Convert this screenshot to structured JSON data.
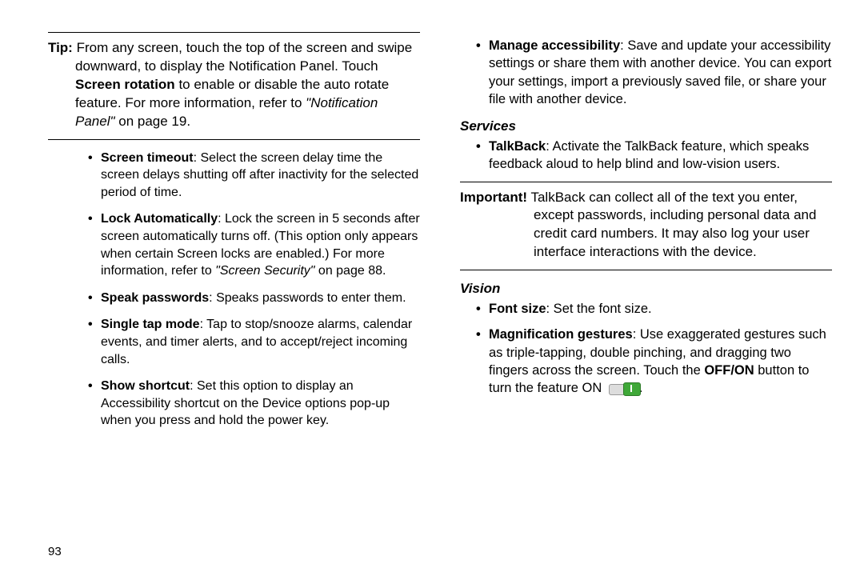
{
  "page_number": "93",
  "left": {
    "tip": {
      "label": "Tip:",
      "text_1": "From any screen, touch the top of the screen and swipe downward, to display the Notification Panel. Touch ",
      "screen_rotation": "Screen rotation",
      "text_2": " to enable or disable the auto rotate feature. For more information, refer to ",
      "ref": "\"Notification Panel\"",
      "text_3": " on page 19."
    },
    "items": [
      {
        "term": "Screen timeout",
        "body": ": Select the screen delay time the screen delays shutting off after inactivity for the selected period of time."
      },
      {
        "term": "Lock Automatically",
        "body_1": ": Lock the screen in 5 seconds after screen automatically turns off. (This option only appears when certain Screen locks are enabled.) For more information, refer to ",
        "ref": "\"Screen Security\"",
        "body_2": " on page 88."
      },
      {
        "term": "Speak passwords",
        "body": ": Speaks passwords to enter them."
      },
      {
        "term": "Single tap mode",
        "body": ": Tap to stop/snooze alarms, calendar events, and timer alerts, and to accept/reject incoming calls."
      },
      {
        "term": "Show shortcut",
        "body": ": Set this option to display an Accessibility shortcut on the Device options pop-up when you press and hold the power key."
      }
    ]
  },
  "right": {
    "top_items": [
      {
        "term": "Manage accessibility",
        "body": ": Save and update your accessibility settings or share them with another device. You can export your settings, import a previously saved file, or share your file with another device."
      }
    ],
    "services_heading": "Services",
    "services_items": [
      {
        "term": "TalkBack",
        "body": ": Activate the TalkBack feature, which speaks feedback aloud to help blind and low-vision users."
      }
    ],
    "important": {
      "label": "Important!",
      "body": " TalkBack can collect all of the text you enter, except passwords, including personal data and credit card numbers. It may also log your user interface interactions with the device."
    },
    "vision_heading": "Vision",
    "vision_items": [
      {
        "term": "Font size",
        "body": ": Set the font size."
      },
      {
        "term": "Magnification gestures",
        "body_1": ": Use exaggerated gestures such as triple-tapping, double pinching, and dragging two fingers across the screen. Touch the ",
        "off_on": "OFF/ON",
        "body_2": " button to turn the feature ON ",
        "post": "."
      }
    ]
  }
}
